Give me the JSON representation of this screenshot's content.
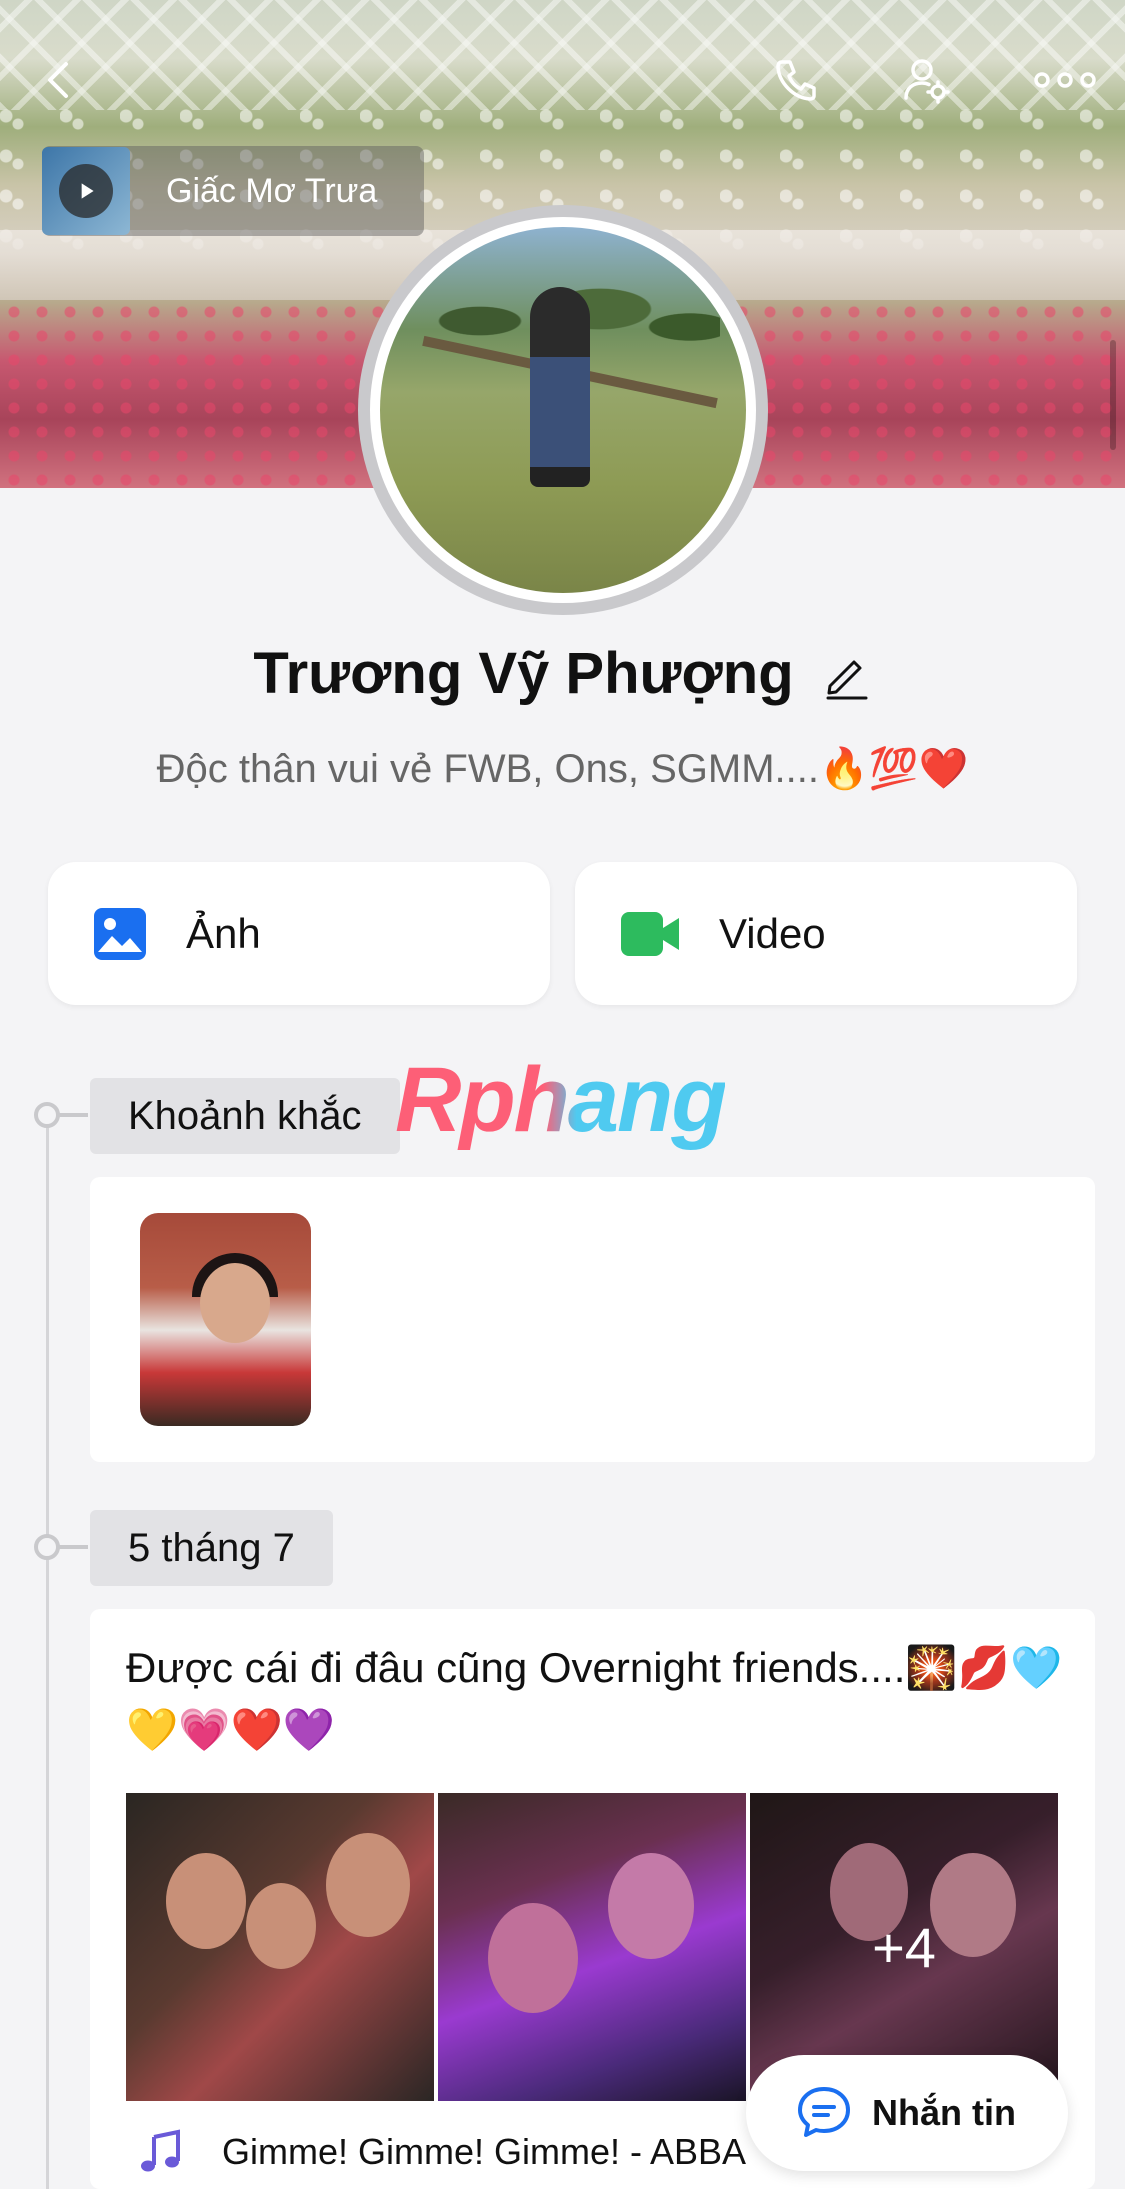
{
  "cover": {
    "music": {
      "title": "Giấc Mơ Trưa"
    }
  },
  "profile": {
    "name": "Trương Vỹ Phượng",
    "bio": "Độc thân vui vẻ FWB, Ons, SGMM....🔥💯❤️"
  },
  "media_buttons": [
    {
      "label": "Ảnh",
      "icon": "image-icon",
      "color": "#1a6ff0"
    },
    {
      "label": "Video",
      "icon": "video-camera-icon",
      "color": "#2dbb5e"
    }
  ],
  "watermark": "Rphang",
  "timeline": {
    "moments_label": "Khoảnh khắc",
    "date_label": "5 tháng 7",
    "post": {
      "text": "Được cái đi đâu cũng Overnight friends....🎇💋🩵💛💗❤️💜",
      "more_photos": "+4",
      "song": "Gimme! Gimme! Gimme! - ABBA"
    }
  },
  "message_button": {
    "label": "Nhắn tin"
  },
  "colors": {
    "accent": "#1a6ff0",
    "video": "#2dbb5e",
    "background": "#f4f4f6"
  }
}
